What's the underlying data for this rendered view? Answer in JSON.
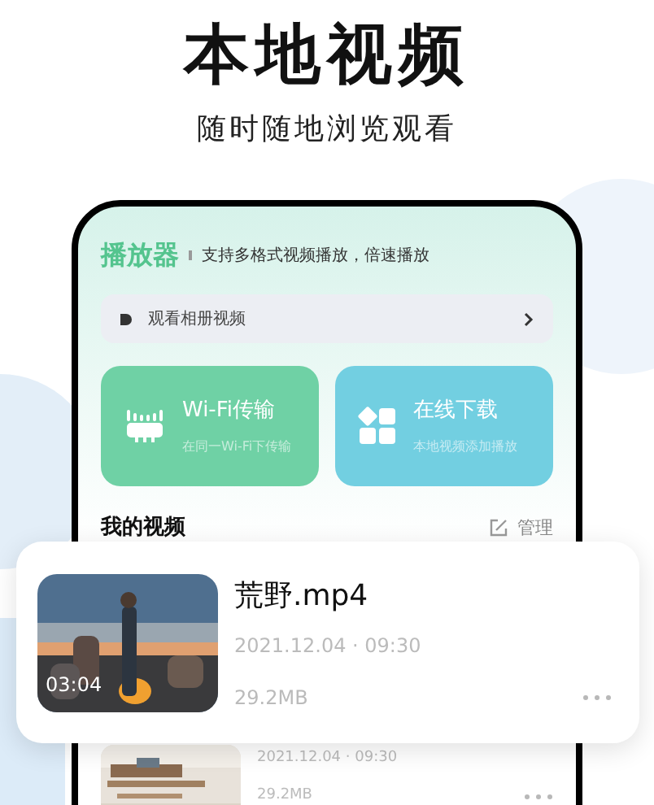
{
  "title": "本地视频",
  "subtitle": "随时随地浏览观看",
  "app": {
    "name": "播放器",
    "tagline": "支持多格式视频播放，倍速播放",
    "album_link": "观看相册视频"
  },
  "actions": [
    {
      "kind": "wifi",
      "title": "Wi-Fi传输",
      "subtitle": "在同一Wi-Fi下传输",
      "color": "#6fd1a5"
    },
    {
      "kind": "download",
      "title": "在线下载",
      "subtitle": "本地视频添加播放",
      "color": "#72cfe1"
    }
  ],
  "section_title": "我的视频",
  "manage": "管理",
  "featured": {
    "name": "荒野.mp4",
    "date": "2021.12.04 · 09:30",
    "size": "29.2MB",
    "duration": "03:04"
  },
  "videos": [
    {
      "date": "2021.12.04 · 09:30",
      "size": "29.2MB"
    }
  ]
}
